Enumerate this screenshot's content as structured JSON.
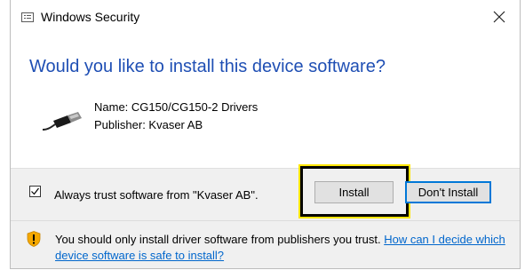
{
  "window": {
    "title": "Windows Security",
    "title_icon": "window-list-icon",
    "close_icon": "close-icon"
  },
  "prompt": {
    "heading": "Would you like to install this device software?"
  },
  "device": {
    "icon": "usb-cable-icon",
    "name_line": "Name: CG150/CG150-2 Drivers",
    "publisher_line": "Publisher: Kvaser AB"
  },
  "footer": {
    "always_trust_label": "Always trust software from \"Kvaser AB\".",
    "always_trust_checked": true,
    "install_label": "Install",
    "dont_install_label": "Don't Install",
    "highlight_color": "#ffe600"
  },
  "warning": {
    "icon": "shield-warning-icon",
    "text": "You should only install driver software from publishers you trust. ",
    "link_text": "How can I decide which device software is safe to install?",
    "accent_color": "#0066cc"
  }
}
